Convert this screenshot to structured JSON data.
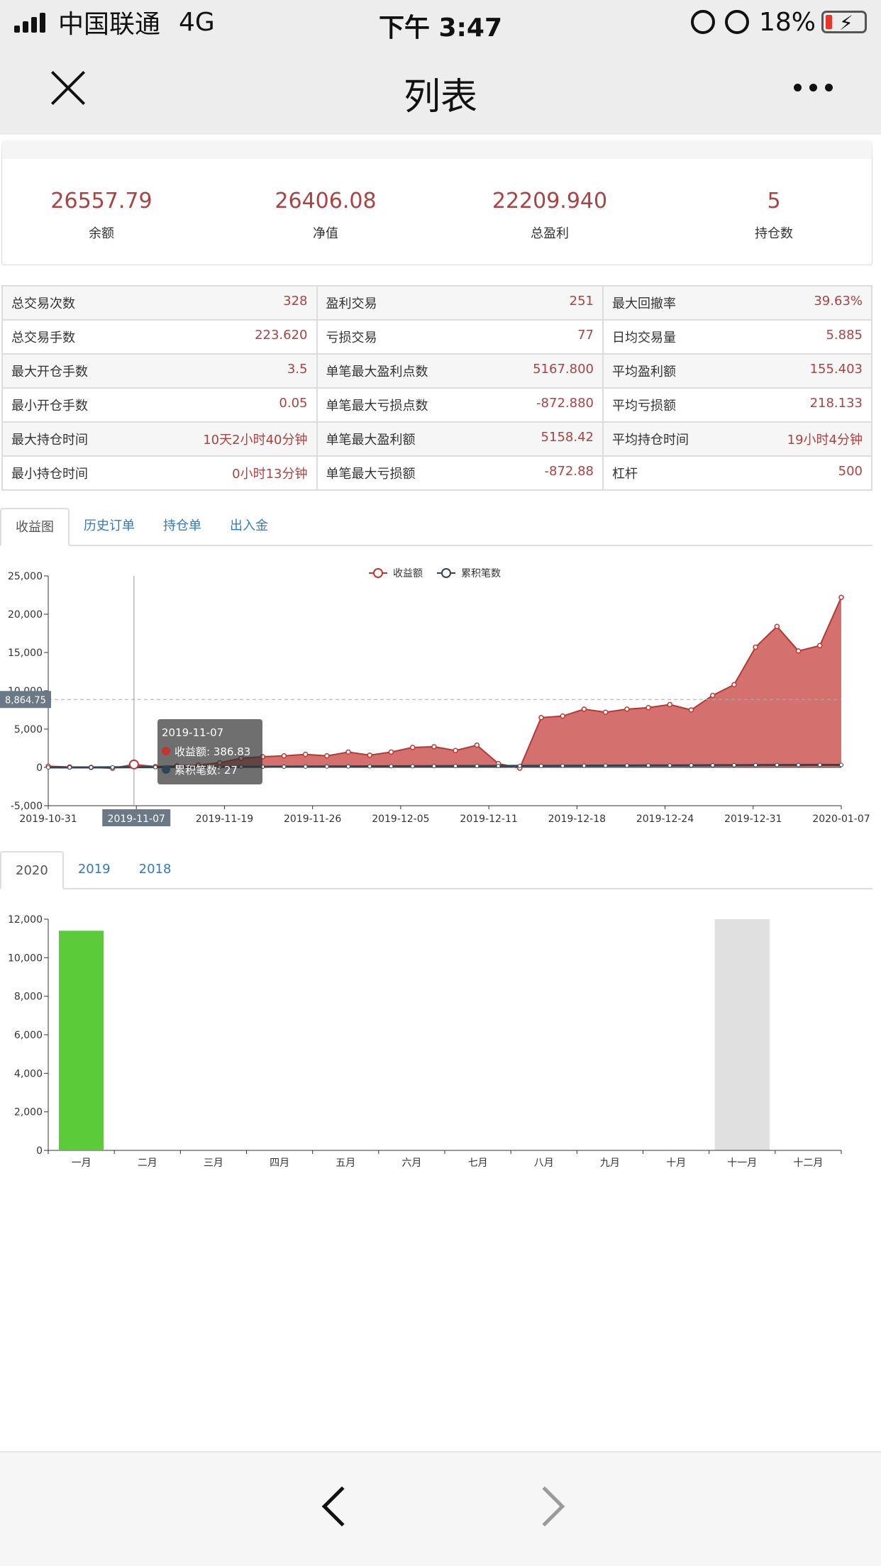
{
  "status_bar": {
    "carrier": "中国联通",
    "network": "4G",
    "time": "下午 3:47",
    "battery": "18%"
  },
  "nav": {
    "title": "列表"
  },
  "summary": [
    {
      "value": "26557.79",
      "label": "余额"
    },
    {
      "value": "26406.08",
      "label": "净值"
    },
    {
      "value": "22209.940",
      "label": "总盈利"
    },
    {
      "value": "5",
      "label": "持仓数"
    }
  ],
  "stats": [
    [
      {
        "k": "总交易次数",
        "v": "328"
      },
      {
        "k": "盈利交易",
        "v": "251"
      },
      {
        "k": "最大回撤率",
        "v": "39.63%"
      }
    ],
    [
      {
        "k": "总交易手数",
        "v": "223.620"
      },
      {
        "k": "亏损交易",
        "v": "77"
      },
      {
        "k": "日均交易量",
        "v": "5.885"
      }
    ],
    [
      {
        "k": "最大开仓手数",
        "v": "3.5"
      },
      {
        "k": "单笔最大盈利点数",
        "v": "5167.800"
      },
      {
        "k": "平均盈利额",
        "v": "155.403"
      }
    ],
    [
      {
        "k": "最小开仓手数",
        "v": "0.05"
      },
      {
        "k": "单笔最大亏损点数",
        "v": "-872.880"
      },
      {
        "k": "平均亏损额",
        "v": "218.133"
      }
    ],
    [
      {
        "k": "最大持仓时间",
        "v": "10天2小时40分钟"
      },
      {
        "k": "单笔最大盈利额",
        "v": "5158.42"
      },
      {
        "k": "平均持仓时间",
        "v": "19小时4分钟"
      }
    ],
    [
      {
        "k": "最小持仓时间",
        "v": "0小时13分钟"
      },
      {
        "k": "单笔最大亏损额",
        "v": "-872.88"
      },
      {
        "k": "杠杆",
        "v": "500"
      }
    ]
  ],
  "tabs1": [
    "收益图",
    "历史订单",
    "持仓单",
    "出入金"
  ],
  "tabs2": [
    "2020",
    "2019",
    "2018"
  ],
  "chart_data": [
    {
      "type": "area",
      "legend": [
        "收益额",
        "累积笔数"
      ],
      "legend_position": "top-center",
      "ylim": [
        -5000,
        25000
      ],
      "yticks": [
        "25,000",
        "20,000",
        "15,000",
        "10,000",
        "5,000",
        "0",
        "-5,000"
      ],
      "xticks": [
        "2019-10-31",
        "2019-11-07",
        "2019-11-19",
        "2019-11-26",
        "2019-12-05",
        "2019-12-11",
        "2019-12-18",
        "2019-12-24",
        "2019-12-31",
        "2020-01-07"
      ],
      "series": [
        {
          "name": "收益额",
          "color": "#c23531",
          "values": [
            150,
            50,
            0,
            -100,
            386.83,
            100,
            200,
            300,
            600,
            1200,
            1400,
            1500,
            1700,
            1500,
            2000,
            1600,
            2000,
            2600,
            2700,
            2200,
            2900,
            500,
            -100,
            6500,
            6700,
            7600,
            7200,
            7600,
            7800,
            8200,
            7500,
            9400,
            10800,
            15700,
            18400,
            15200,
            15900,
            22200
          ]
        },
        {
          "name": "累积笔数",
          "color": "#2f4554",
          "values": [
            0,
            2,
            5,
            8,
            27,
            35,
            45,
            55,
            65,
            75,
            85,
            95,
            105,
            115,
            125,
            135,
            145,
            155,
            165,
            175,
            185,
            190,
            195,
            200,
            210,
            220,
            230,
            240,
            250,
            260,
            270,
            280,
            290,
            300,
            310,
            318,
            324,
            328
          ]
        }
      ],
      "marker": {
        "label": "8,864.75",
        "value": 8864.75
      },
      "tooltip": {
        "date": "2019-11-07",
        "line1": "收益额: 386.83",
        "line2": "累积笔数: 27"
      }
    },
    {
      "type": "bar",
      "categories": [
        "一月",
        "二月",
        "三月",
        "四月",
        "五月",
        "六月",
        "七月",
        "八月",
        "九月",
        "十月",
        "十一月",
        "十二月"
      ],
      "values": [
        11400,
        0,
        0,
        0,
        0,
        0,
        0,
        0,
        0,
        0,
        0,
        0
      ],
      "highlight": {
        "index": 10,
        "color": "#e0e0e0"
      },
      "ylim": [
        0,
        12000
      ],
      "yticks": [
        "12,000",
        "10,000",
        "8,000",
        "6,000",
        "4,000",
        "2,000",
        "0"
      ],
      "bar_color": "#5bcb3a"
    }
  ]
}
